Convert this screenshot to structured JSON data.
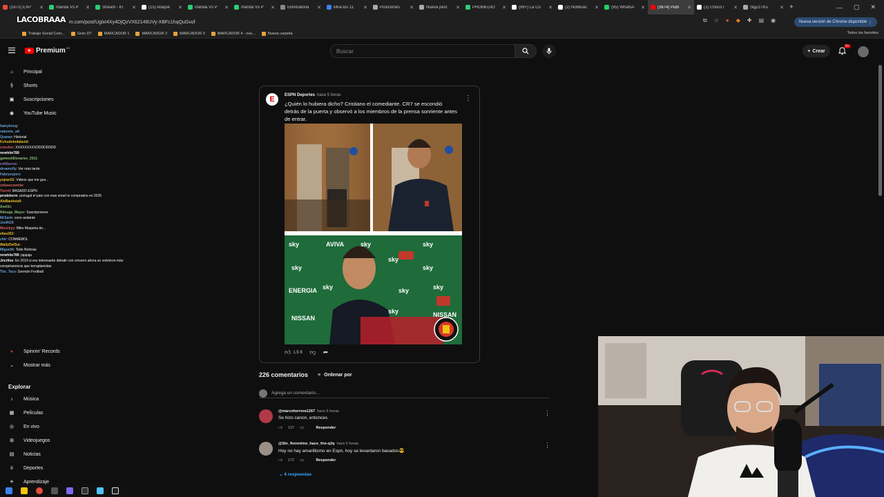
{
  "browser": {
    "tabs": [
      {
        "label": "(1672) EXP",
        "color": "#e74c3c"
      },
      {
        "label": "Irlanda Vs P",
        "color": "#2ecc71"
      },
      {
        "label": "Stream - Ki",
        "color": "#2ecc71"
      },
      {
        "label": "(15) Ataque",
        "color": "#ffffff"
      },
      {
        "label": "Irlanda Vs P",
        "color": "#2ecc71"
      },
      {
        "label": "Irlanda Vs P",
        "color": "#2ecc71"
      },
      {
        "label": "Eliminatoria",
        "color": "#888888"
      },
      {
        "label": "Mira los 11",
        "color": "#3b82f6"
      },
      {
        "label": "Posiciones",
        "color": "#aaaaaa"
      },
      {
        "label": "Nueva pest",
        "color": "#aaaaaa"
      },
      {
        "label": "PROMEDIO",
        "color": "#2ecc71"
      },
      {
        "label": "(99+) La Co",
        "color": "#ffffff"
      },
      {
        "label": "(2) Notificac",
        "color": "#ffffff"
      },
      {
        "label": "(95) WhatsA",
        "color": "#25d366"
      },
      {
        "label": "(3674) Publ",
        "color": "#ff0000"
      },
      {
        "label": "(2) ChocoT",
        "color": "#ffffff"
      },
      {
        "label": "SlgZz7Ku",
        "color": "#aaaaaa"
      }
    ],
    "active_tab_index": 14,
    "url": "m.com/post/UglxI4Xy4DjQzVX62149UVy-XBFc1hqQuGvof",
    "channel_logo_text": "LACOBRAAA",
    "update_chip": "Nueva versión de Chrome disponible",
    "bookmarks": [
      "Trabajo Social Com...",
      "Gran DT",
      "MARCADOR 1",
      "MARCADOR 2",
      "MARCADOR 3",
      "MARCADOR 4 - ove...",
      "Nueva carpeta"
    ],
    "all_favorites": "Todos los favoritos"
  },
  "header": {
    "logo": "Premium",
    "logo_region": "AR",
    "search_placeholder": "Buscar",
    "create_label": "Crear",
    "notifications": "9+"
  },
  "sidebar": {
    "top_items": [
      {
        "label": "Principal",
        "icon": "home-icon"
      },
      {
        "label": "Shorts",
        "icon": "shorts-icon"
      },
      {
        "label": "Suscripciones",
        "icon": "subscriptions-icon"
      },
      {
        "label": "YouTube Music",
        "icon": "music-icon"
      }
    ],
    "bottom_items": [
      {
        "label": "Spinnin' Records",
        "icon": "avatar-icon"
      },
      {
        "label": "Mostrar más",
        "icon": "chevron-down-icon"
      }
    ],
    "explore_title": "Explorar",
    "explore_items": [
      {
        "label": "Música",
        "icon": "music-note-icon"
      },
      {
        "label": "Películas",
        "icon": "film-icon"
      },
      {
        "label": "En vivo",
        "icon": "live-icon"
      },
      {
        "label": "Videojuegos",
        "icon": "gamepad-icon"
      },
      {
        "label": "Noticias",
        "icon": "news-icon"
      },
      {
        "label": "Deportes",
        "icon": "trophy-icon"
      },
      {
        "label": "Aprendizaje",
        "icon": "bulb-icon"
      }
    ]
  },
  "chat": [
    {
      "user": "haleyboog",
      "msg": ":",
      "color": "#6fa8dc"
    },
    {
      "user": "nakoots_a4",
      "msg": ":",
      "color": "#6fa8dc"
    },
    {
      "user": "Quaran",
      "msg": ": Historial",
      "color": "#6fa8dc"
    },
    {
      "user": "Kchudotodalavid",
      "msg": ":",
      "color": "#f1c232"
    },
    {
      "user": "crisvilor",
      "msg": ": XXXXXXXXXDDDDDDDD",
      "color": "#e06666"
    },
    {
      "user": "mrwhite789",
      "msg": ":",
      "color": "#ffffff"
    },
    {
      "user": "gameshDenaries_2011",
      "msg": ":",
      "color": "#93c47d"
    },
    {
      "user": "erkRarroa",
      "msg": ":",
      "color": "#8e7cc3"
    },
    {
      "user": "dreamsfly",
      "msg": ": Ver más tarde",
      "color": "#6fa8dc"
    },
    {
      "user": "Fabryoujoro",
      "msg": ":",
      "color": "#6fa8dc"
    },
    {
      "user": "yojran31",
      "msg": ": Videos que me gus...",
      "color": "#f1c232"
    },
    {
      "user": "zidanecomida",
      "msg": ":",
      "color": "#e06666"
    },
    {
      "user": "Tiernit",
      "msg": ": BASADO ESPN",
      "color": "#e06666"
    },
    {
      "user": "prodelecm",
      "msg": ": portugal el pais con mas smart tv comprados en 2026",
      "color": "#ffffff"
    },
    {
      "user": "AleBautista9",
      "msg": ":",
      "color": "#f1c232"
    },
    {
      "user": "Axel3z",
      "msg": ":",
      "color": "#93c47d"
    },
    {
      "user": "Nitsuga_Mayer",
      "msg": ": Suscripciones",
      "color": "#93c47d"
    },
    {
      "user": "MrSank",
      "msg": ": cono andante",
      "color": "#6fa8dc"
    },
    {
      "user": "JonRG9",
      "msg": ":",
      "color": "#6fa8dc"
    },
    {
      "user": "Mosckyy",
      "msg": ": Mike Maquina de...",
      "color": "#e06666"
    },
    {
      "user": "elias263",
      "msg": ":",
      "color": "#f1c232"
    },
    {
      "user": "chtr",
      "msg": ": CONMEBOL",
      "color": "#6fa8dc"
    },
    {
      "user": "WallyDelSur",
      "msg": ":",
      "color": "#f1c232"
    },
    {
      "user": "Miguelik",
      "msg": ": Todo Noticias",
      "color": "#6fa8dc"
    },
    {
      "user": "mrwhite789",
      "msg": ": jajajaja",
      "color": "#ffffff"
    },
    {
      "user": "Jncrilos",
      "msg": ": En 2019 si era interesante debatir con crisvero ahora se volvieron más conspiranoicos que terraplanistas",
      "color": "#ffffff"
    },
    {
      "user": "Tito_Tacs",
      "msg": ": Germán Football",
      "color": "#6fa8dc"
    }
  ],
  "post": {
    "author": "ESPN Deportes",
    "time": "hace 5 horas",
    "text": "¿Quién lo hubiera dicho? Cristiano el comediante. CR7 se escondió detrás de la puerta y observó a los miembros de la prensa sonriente antes de entrar.",
    "likes": "1.5 K"
  },
  "comments": {
    "count": "226 comentarios",
    "sort_label": "Ordenar por",
    "add_placeholder": "Agrega un comentario...",
    "items": [
      {
        "author": "@marcoherrera1267",
        "time": "hace 5 horas",
        "text": "Se hizo canon, entonces",
        "likes": "137",
        "reply": "Responder",
        "avatar_color": "#b03a48"
      },
      {
        "author": "@Sin_florentino_hace_frio-q3q",
        "time": "hace 5 horas",
        "text": "Hoy no hay amarillismo en Espn, hoy se levantaron basados😎",
        "likes": "172",
        "reply": "Responder",
        "avatar_color": "#9a8f86"
      }
    ],
    "replies_label": "4 respuestas"
  }
}
